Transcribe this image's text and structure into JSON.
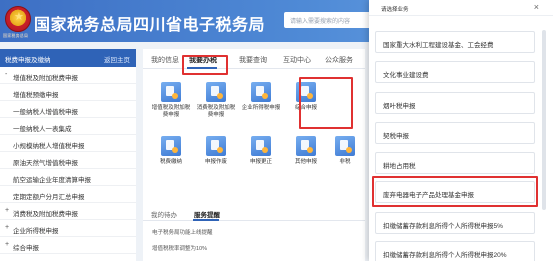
{
  "header": {
    "site_title": "国家税务总局四川省电子税务局",
    "caption": "国家税务总局",
    "search_placeholder": "请输入需要搜索的内容"
  },
  "sidebar": {
    "title": "税费申报及缴纳",
    "back": "返回主页",
    "items": [
      {
        "label": "增值税及附加税费申报",
        "level": 1,
        "expanded": true
      },
      {
        "label": "增值税预缴申报",
        "level": 2
      },
      {
        "label": "一般纳税人增值税申报",
        "level": 2
      },
      {
        "label": "一般纳税人一表集成",
        "level": 2
      },
      {
        "label": "小规模纳税人增值税申报",
        "level": 2
      },
      {
        "label": "原油天然气增值税申报",
        "level": 2
      },
      {
        "label": "航空运输企业年度清算申报",
        "level": 2
      },
      {
        "label": "定期定额户分月汇总申报",
        "level": 2
      },
      {
        "label": "消费税及附加税费申报",
        "level": 1,
        "expanded": false
      },
      {
        "label": "企业所得税申报",
        "level": 1,
        "expanded": false
      },
      {
        "label": "综合申报",
        "level": 1,
        "expanded": false
      }
    ]
  },
  "main": {
    "tabs": [
      "我的信息",
      "我要办税",
      "我要查询",
      "互动中心",
      "公众服务"
    ],
    "active_tab": "我要办税",
    "tiles_row1": [
      {
        "label": "增值税及附加税费申报",
        "icon": "declaration-icon"
      },
      {
        "label": "消费税及附加税费申报",
        "icon": "declaration-icon"
      },
      {
        "label": "企业所得税申报",
        "icon": "declaration-icon"
      },
      {
        "label": "综合申报",
        "icon": "comprehensive-icon"
      }
    ],
    "tiles_row2": [
      {
        "label": "税费缴纳",
        "icon": "payment-icon"
      },
      {
        "label": "申报作废",
        "icon": "void-icon"
      },
      {
        "label": "申报更正",
        "icon": "correction-icon"
      },
      {
        "label": "其他申报",
        "icon": "other-icon"
      },
      {
        "label": "非税",
        "icon": "tax-icon"
      }
    ],
    "sub_tabs": [
      "我的待办",
      "服务提醒"
    ],
    "active_sub_tab": "服务提醒",
    "messages": [
      "电子税务局功能上线提醒",
      "增值税税率调整为10%"
    ]
  },
  "panel": {
    "title": "请选择业务",
    "close": "×",
    "options": [
      "国家重大水利工程建设基金、工会经费",
      "文化事业建设费",
      "烟叶税申报",
      "契税申报",
      "耕地占用税",
      "废弃电器电子产品处理基金申报",
      "扣缴储蓄存款利息所得个人所得税申报5%",
      "扣缴储蓄存款利息所得个人所得税申报20%"
    ],
    "highlighted_option": "废弃电器电子产品处理基金申报"
  },
  "colors": {
    "brand_blue": "#2f63b7",
    "header_gradient_start": "#3d6fc4",
    "highlight_red": "#e03131"
  }
}
